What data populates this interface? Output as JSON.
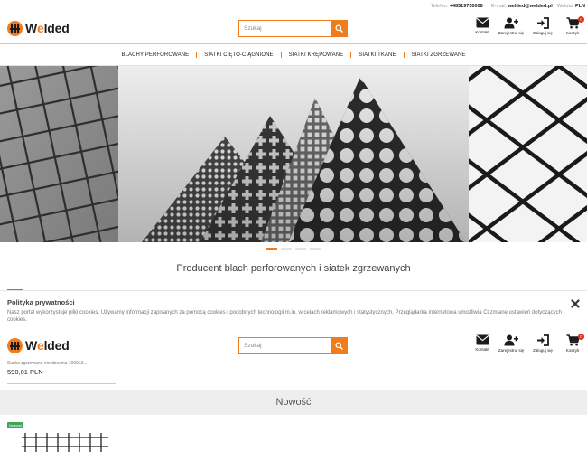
{
  "topbar": {
    "phone_label": "Telefon:",
    "phone_value": "+48519755008",
    "email_label": "E-mail:",
    "email_value": "welded@welded.pl",
    "currency_label": "Waluta:",
    "currency_value": "PLN"
  },
  "logo": {
    "text_prefix": "W",
    "text_accent": "e",
    "text_suffix": "lded"
  },
  "search": {
    "placeholder": "Szukaj"
  },
  "header_icons": {
    "contact_label": "Kontakt",
    "register_label": "Zarejestruj się",
    "login_label": "Zaloguj się",
    "cart_label": "Koszyk",
    "cart_count": "0"
  },
  "nav": {
    "items": [
      "BLACHY PERFOROWANE",
      "SIATKI CIĘTO-CIĄGNIONE",
      "SIATKI KRĘPOWANE",
      "SIATKI TKANE",
      "SIATKI ZGRZEWANE"
    ]
  },
  "hero": {
    "active_slide": 1,
    "slide_count": 4
  },
  "tagline": "Producent blach perforowanych i siatek zgrzewanych",
  "cookie": {
    "title": "Polityka prywatności",
    "text": "Nasz portal wykorzystuje pliki cookies. Używamy informacji zapisanych za pomocą cookies i podobnych technologii m.in. w celach reklamowych i statystycznych. Przeglądarka internetowa umożliwia Ci zmianę ustawień dotyczących cookies."
  },
  "product": {
    "name": "Siatka zgrzewana nierdzewna 1000x2...",
    "price": "590,01 PLN"
  },
  "section": {
    "title": "Nowość"
  },
  "badge": {
    "label": "Nowość"
  },
  "colors": {
    "accent": "#f07c1d",
    "green": "#3aa757",
    "cart_badge": "#e0301e"
  }
}
